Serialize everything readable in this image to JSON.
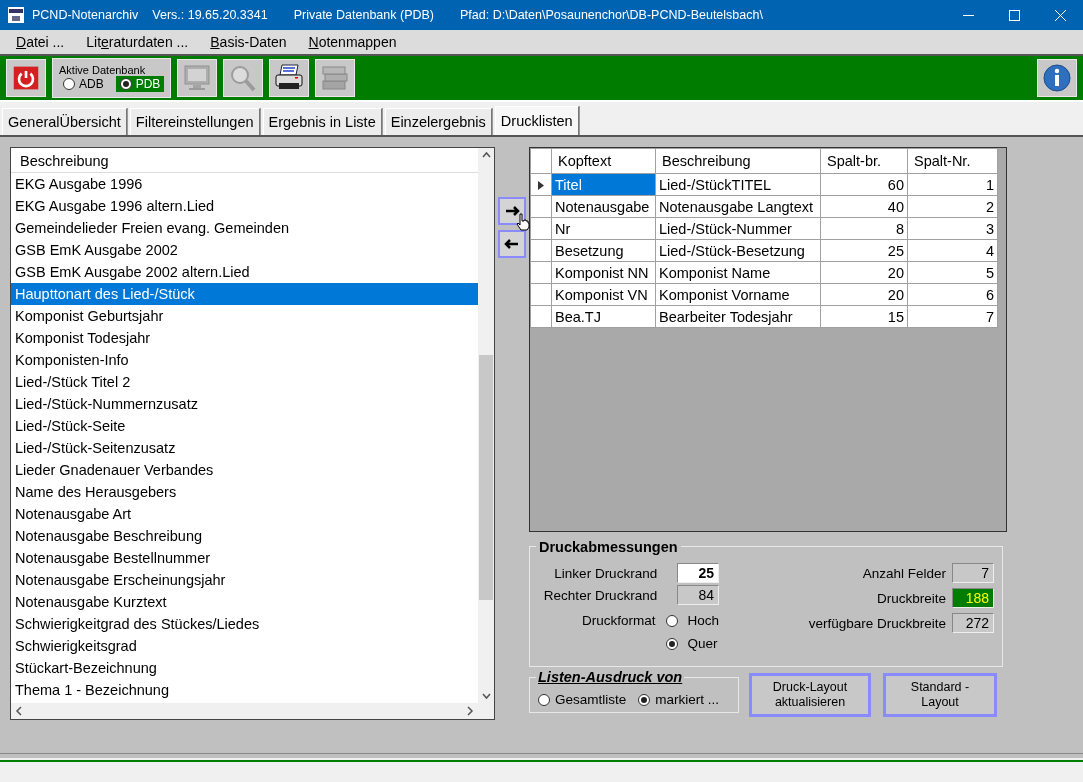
{
  "window": {
    "title_parts": [
      "PCND-Notenarchiv",
      "Vers.: 19.65.20.3341",
      "Private Datenbank (PDB)",
      "Pfad: D:\\Daten\\Posaunenchor\\DB-PCND-Beutelsbach\\"
    ]
  },
  "menu": [
    {
      "access_key": "D",
      "after": "atei ..."
    },
    {
      "before": "Lit",
      "access_key": "e",
      "after": "raturdaten ..."
    },
    {
      "access_key": "B",
      "after": "asis-Daten"
    },
    {
      "access_key": "N",
      "after": "otenmappen"
    }
  ],
  "toolbar": {
    "database_group": {
      "title": "Aktive Datenbank",
      "options": [
        {
          "label": "ADB",
          "selected": false
        },
        {
          "label": "PDB",
          "selected": true
        }
      ]
    },
    "buttons": [
      {
        "kind": "monitor",
        "disabled": true
      },
      {
        "kind": "search",
        "disabled": true
      },
      {
        "kind": "printer",
        "disabled": false
      },
      {
        "kind": "books",
        "disabled": true
      }
    ]
  },
  "tabs": [
    {
      "label": "GeneralÜbersicht",
      "selected": false
    },
    {
      "label": "Filtereinstellungen",
      "selected": false
    },
    {
      "label": "Ergebnis in Liste",
      "selected": false
    },
    {
      "label": "Einzelergebnis",
      "selected": false
    },
    {
      "label": "Drucklisten",
      "selected": true
    }
  ],
  "field_list": {
    "header": "Beschreibung",
    "items": [
      {
        "label": "EKG Ausgabe 1996",
        "selected": false
      },
      {
        "label": "EKG Ausgabe 1996 altern.Lied",
        "selected": false
      },
      {
        "label": "Gemeindelieder Freien evang. Gemeinden",
        "selected": false
      },
      {
        "label": "GSB EmK Ausgabe 2002",
        "selected": false
      },
      {
        "label": "GSB EmK Ausgabe 2002 altern.Lied",
        "selected": false
      },
      {
        "label": "Haupttonart des Lied-/Stück",
        "selected": true
      },
      {
        "label": "Komponist Geburtsjahr",
        "selected": false
      },
      {
        "label": "Komponist Todesjahr",
        "selected": false
      },
      {
        "label": "Komponisten-Info",
        "selected": false
      },
      {
        "label": "Lied-/Stück Titel 2",
        "selected": false
      },
      {
        "label": "Lied-/Stück-Nummernzusatz",
        "selected": false
      },
      {
        "label": "Lied-/Stück-Seite",
        "selected": false
      },
      {
        "label": "Lied-/Stück-Seitenzusatz",
        "selected": false
      },
      {
        "label": "Lieder Gnadenauer Verbandes",
        "selected": false
      },
      {
        "label": "Name des Herausgebers",
        "selected": false
      },
      {
        "label": "Notenausgabe Art",
        "selected": false
      },
      {
        "label": "Notenausgabe Beschreibung",
        "selected": false
      },
      {
        "label": "Notenausgabe Bestellnummer",
        "selected": false
      },
      {
        "label": "Notenausgabe Erscheinungsjahr",
        "selected": false
      },
      {
        "label": "Notenausgabe Kurztext",
        "selected": false
      },
      {
        "label": "Schwierigkeitgrad des Stückes/Liedes",
        "selected": false
      },
      {
        "label": "Schwierigkeitsgrad",
        "selected": false
      },
      {
        "label": "Stückart-Bezeichnung",
        "selected": false
      },
      {
        "label": "Thema 1 - Bezeichnung",
        "selected": false
      }
    ]
  },
  "grid": {
    "columns": [
      "Kopftext",
      "Beschreibung",
      "Spalt-br.",
      "Spalt-Nr."
    ],
    "rows": [
      {
        "cells": [
          "Titel",
          "Lied-/StückTITEL",
          "60",
          "1"
        ],
        "selected": true
      },
      {
        "cells": [
          "Notenausgabe",
          "Notenausgabe Langtext",
          "40",
          "2"
        ],
        "selected": false
      },
      {
        "cells": [
          "Nr",
          "Lied-/Stück-Nummer",
          "8",
          "3"
        ],
        "selected": false
      },
      {
        "cells": [
          "Besetzung",
          "Lied-/Stück-Besetzung",
          "25",
          "4"
        ],
        "selected": false
      },
      {
        "cells": [
          "Komponist NN",
          "Komponist Name",
          "20",
          "5"
        ],
        "selected": false
      },
      {
        "cells": [
          "Komponist VN",
          "Komponist Vorname",
          "20",
          "6"
        ],
        "selected": false
      },
      {
        "cells": [
          "Bea.TJ",
          "Bearbeiter Todesjahr",
          "15",
          "7"
        ],
        "selected": false
      }
    ]
  },
  "dimensions": {
    "title": "Druckabmessungen",
    "left_fields": [
      {
        "label": "Linker Druckrand",
        "value": "25",
        "editable": true
      },
      {
        "label": "Rechter Druckrand",
        "value": "84",
        "editable": false
      }
    ],
    "format": {
      "label": "Druckformat",
      "options": [
        {
          "label": "Hoch",
          "selected": false
        },
        {
          "label": "Quer",
          "selected": true
        }
      ]
    },
    "right_fields": [
      {
        "label": "Anzahl Felder",
        "value": "7",
        "highlight": false
      },
      {
        "label": "Druckbreite",
        "value": "188",
        "highlight": true
      },
      {
        "label": "verfügbare Druckbreite",
        "value": "272",
        "highlight": false
      }
    ]
  },
  "print_scope": {
    "title": "Listen-Ausdruck von",
    "options": [
      {
        "label": "Gesamtliste",
        "selected": false
      },
      {
        "label": "markiert ...",
        "selected": true
      }
    ]
  },
  "buttons": [
    "Druck-Layout aktualisieren",
    "Standard - Layout"
  ]
}
